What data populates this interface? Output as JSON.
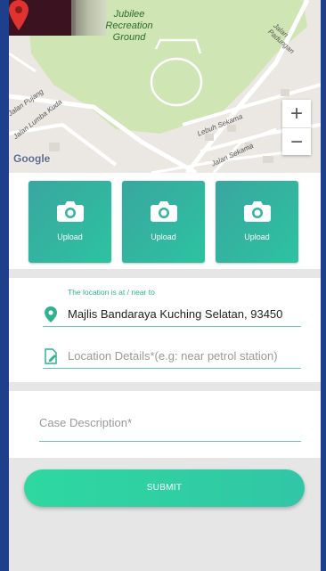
{
  "map": {
    "park_label": "Jubilee Recreation Ground",
    "streets": [
      "Jalan Padungan",
      "Jalan Pujang",
      "Jalan Lumba Kuda",
      "Lebuh Sekama",
      "Jalan Sekama"
    ],
    "zoom_in": "+",
    "zoom_out": "−",
    "attribution": "Google"
  },
  "uploads": [
    {
      "label": "Upload",
      "icon": "camera-icon"
    },
    {
      "label": "Upload",
      "icon": "camera-icon"
    },
    {
      "label": "Upload",
      "icon": "camera-icon"
    }
  ],
  "location": {
    "hint": "The location is at / near to",
    "value": "Majlis Bandaraya Kuching Selatan, 93450",
    "details_placeholder": "Location Details*(e.g: near petrol station)"
  },
  "case": {
    "placeholder": "Case Description*"
  },
  "submit_label": "SUBMIT",
  "colors": {
    "accent": "#2fb28f",
    "tile": "#36b3a0",
    "submit": "#2ed8a0",
    "background": "#1d3f8c"
  }
}
